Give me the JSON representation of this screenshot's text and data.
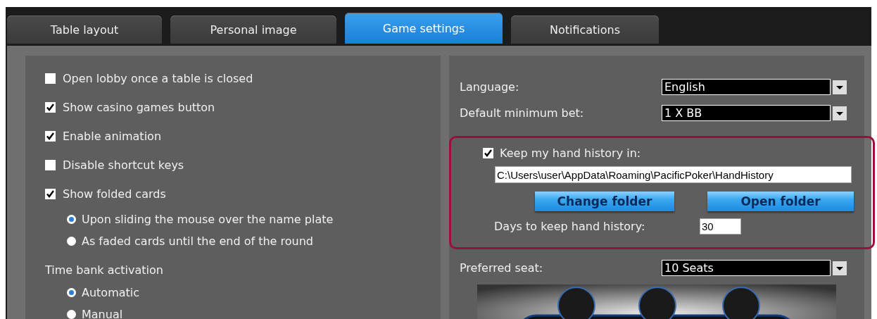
{
  "tabs": [
    {
      "label": "Table layout",
      "selected": false
    },
    {
      "label": "Personal image",
      "selected": false
    },
    {
      "label": "Game settings",
      "selected": true
    },
    {
      "label": "Notifications",
      "selected": false
    }
  ],
  "general_options": [
    {
      "kind": "checkbox",
      "label": "Open lobby once a table is closed",
      "checked": false
    },
    {
      "kind": "checkbox",
      "label": "Show casino games button",
      "checked": true
    },
    {
      "kind": "checkbox",
      "label": "Enable animation",
      "checked": true
    },
    {
      "kind": "checkbox",
      "label": "Disable shortcut keys",
      "checked": false
    },
    {
      "kind": "checkbox",
      "label": "Show folded cards",
      "checked": true
    },
    {
      "kind": "radio",
      "label": "Upon sliding the mouse over the name plate",
      "selected": true
    },
    {
      "kind": "radio",
      "label": "As faded cards until the end of the round",
      "selected": false
    },
    {
      "kind": "heading",
      "label": "Time bank activation"
    },
    {
      "kind": "radio",
      "label": "Automatic",
      "selected": true
    },
    {
      "kind": "radio",
      "label": "Manual",
      "selected": false
    }
  ],
  "language": {
    "label": "Language:",
    "value": "English"
  },
  "min_bet": {
    "label": "Default minimum bet:",
    "value": "1 X BB"
  },
  "hand_history": {
    "label": "Keep my hand history in:",
    "checked": true,
    "path": "C:\\Users\\user\\AppData\\Roaming\\PacificPoker\\HandHistory",
    "buttons": [
      "Change folder",
      "Open folder"
    ],
    "days_label": "Days to keep hand history:",
    "days": "30"
  },
  "preferred_seat": {
    "label": "Preferred seat:",
    "value": "10 Seats"
  }
}
